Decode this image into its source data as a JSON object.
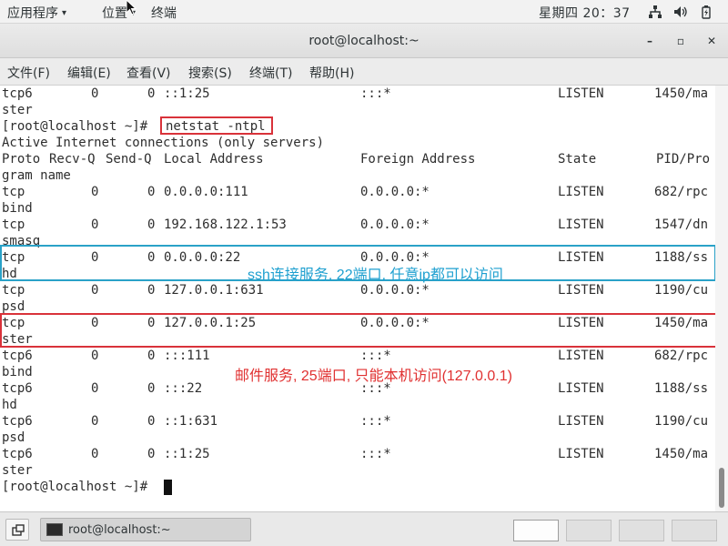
{
  "topbar": {
    "apps_label": "应用程序",
    "places_label": "位置",
    "terminal_label": "终端",
    "clock": "星期四 20：37"
  },
  "window": {
    "title": "root@localhost:~",
    "minimize": "–",
    "maximize": "▫",
    "close": "✕"
  },
  "menubar": {
    "items": [
      "文件(F)",
      "编辑(E)",
      "查看(V)",
      "搜索(S)",
      "终端(T)",
      "帮助(H)"
    ]
  },
  "terminal": {
    "prompt": "[root@localhost ~]# ",
    "command": "netstat -ntpl",
    "header_line1": "Active Internet connections (only servers)",
    "columns": [
      "Proto",
      "Recv-Q",
      "Send-Q",
      "Local Address",
      "Foreign Address",
      "State",
      "PID/Pro"
    ],
    "columns_wrap": "gram name",
    "top_row": {
      "proto": "tcp6",
      "recv": "0",
      "send": "0",
      "local": "::1:25",
      "foreign": ":::*",
      "state": "LISTEN",
      "pid": "1450/ma",
      "wrap": "ster"
    },
    "rows": [
      {
        "proto": "tcp",
        "recv": "0",
        "send": "0",
        "local": "0.0.0.0:111",
        "foreign": "0.0.0.0:*",
        "state": "LISTEN",
        "pid": "682/rpc",
        "wrap": "bind"
      },
      {
        "proto": "tcp",
        "recv": "0",
        "send": "0",
        "local": "192.168.122.1:53",
        "foreign": "0.0.0.0:*",
        "state": "LISTEN",
        "pid": "1547/dn",
        "wrap": "smasq"
      },
      {
        "proto": "tcp",
        "recv": "0",
        "send": "0",
        "local": "0.0.0.0:22",
        "foreign": "0.0.0.0:*",
        "state": "LISTEN",
        "pid": "1188/ss",
        "wrap": "hd"
      },
      {
        "proto": "tcp",
        "recv": "0",
        "send": "0",
        "local": "127.0.0.1:631",
        "foreign": "0.0.0.0:*",
        "state": "LISTEN",
        "pid": "1190/cu",
        "wrap": "psd"
      },
      {
        "proto": "tcp",
        "recv": "0",
        "send": "0",
        "local": "127.0.0.1:25",
        "foreign": "0.0.0.0:*",
        "state": "LISTEN",
        "pid": "1450/ma",
        "wrap": "ster"
      },
      {
        "proto": "tcp6",
        "recv": "0",
        "send": "0",
        "local": ":::111",
        "foreign": ":::*",
        "state": "LISTEN",
        "pid": "682/rpc",
        "wrap": "bind"
      },
      {
        "proto": "tcp6",
        "recv": "0",
        "send": "0",
        "local": ":::22",
        "foreign": ":::*",
        "state": "LISTEN",
        "pid": "1188/ss",
        "wrap": "hd"
      },
      {
        "proto": "tcp6",
        "recv": "0",
        "send": "0",
        "local": "::1:631",
        "foreign": ":::*",
        "state": "LISTEN",
        "pid": "1190/cu",
        "wrap": "psd"
      },
      {
        "proto": "tcp6",
        "recv": "0",
        "send": "0",
        "local": "::1:25",
        "foreign": ":::*",
        "state": "LISTEN",
        "pid": "1450/ma",
        "wrap": "ster"
      }
    ]
  },
  "annotations": {
    "ssh": "ssh连接服务, 22端口, 任意ip都可以访问",
    "mail": "邮件服务, 25端口, 只能本机访问(127.0.0.1)"
  },
  "taskbar": {
    "task_label": "root@localhost:~"
  },
  "colors": {
    "highlight_red": "#d9323a",
    "highlight_blue": "#2aa2c8",
    "annotation_blue": "#1fa0d0",
    "annotation_red": "#e03030"
  }
}
